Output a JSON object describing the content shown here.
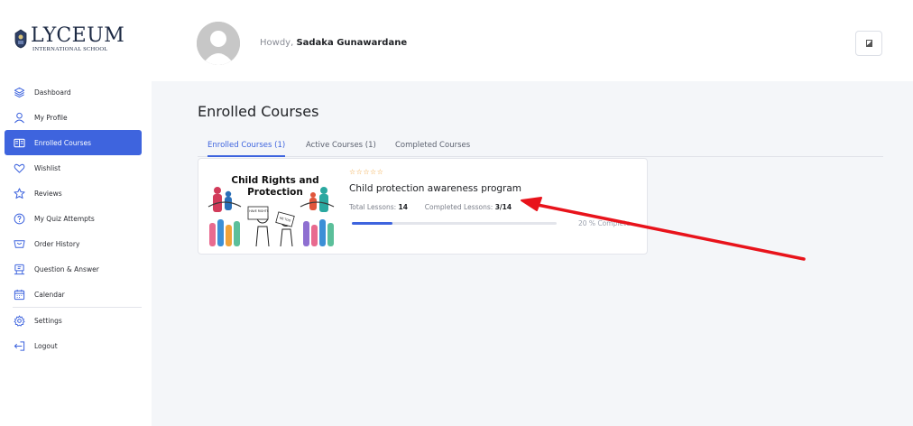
{
  "brand": {
    "name": "LYCEUM",
    "subtitle": "INTERNATIONAL SCHOOL"
  },
  "sidebar": {
    "items": [
      {
        "label": "Dashboard",
        "icon": "dashboard-icon"
      },
      {
        "label": "My Profile",
        "icon": "user-icon"
      },
      {
        "label": "Enrolled Courses",
        "icon": "courses-icon",
        "active": true
      },
      {
        "label": "Wishlist",
        "icon": "heart-icon"
      },
      {
        "label": "Reviews",
        "icon": "star-icon"
      },
      {
        "label": "My Quiz Attempts",
        "icon": "quiz-icon"
      },
      {
        "label": "Order History",
        "icon": "cart-icon"
      },
      {
        "label": "Question & Answer",
        "icon": "question-answer-icon"
      },
      {
        "label": "Calendar",
        "icon": "calendar-icon"
      },
      {
        "label": "Settings",
        "icon": "gear-icon"
      },
      {
        "label": "Logout",
        "icon": "logout-icon"
      }
    ]
  },
  "header": {
    "greeting": "Howdy,",
    "user_name": "Sadaka Gunawardane"
  },
  "main": {
    "title": "Enrolled Courses",
    "tabs": [
      {
        "label": "Enrolled Courses (1)",
        "active": true
      },
      {
        "label": "Active Courses (1)"
      },
      {
        "label": "Completed Courses"
      }
    ],
    "course": {
      "thumbnail_title_line1": "Child Rights and",
      "thumbnail_title_line2": "Protection",
      "thumbnail_sign1": "I HAVE RIGHTS",
      "thumbnail_sign2": "ME TOO",
      "rating_stars": "☆☆☆☆☆",
      "title": "Child protection awareness program",
      "total_lessons_label": "Total Lessons:",
      "total_lessons": "14",
      "completed_lessons_label": "Completed Lessons:",
      "completed_lessons": "3/14",
      "progress_percent": 20,
      "progress_label": "20 % Complete"
    }
  },
  "colors": {
    "accent": "#3e64de",
    "annotation_arrow": "#e8131b",
    "stars": "#f0a33a"
  }
}
